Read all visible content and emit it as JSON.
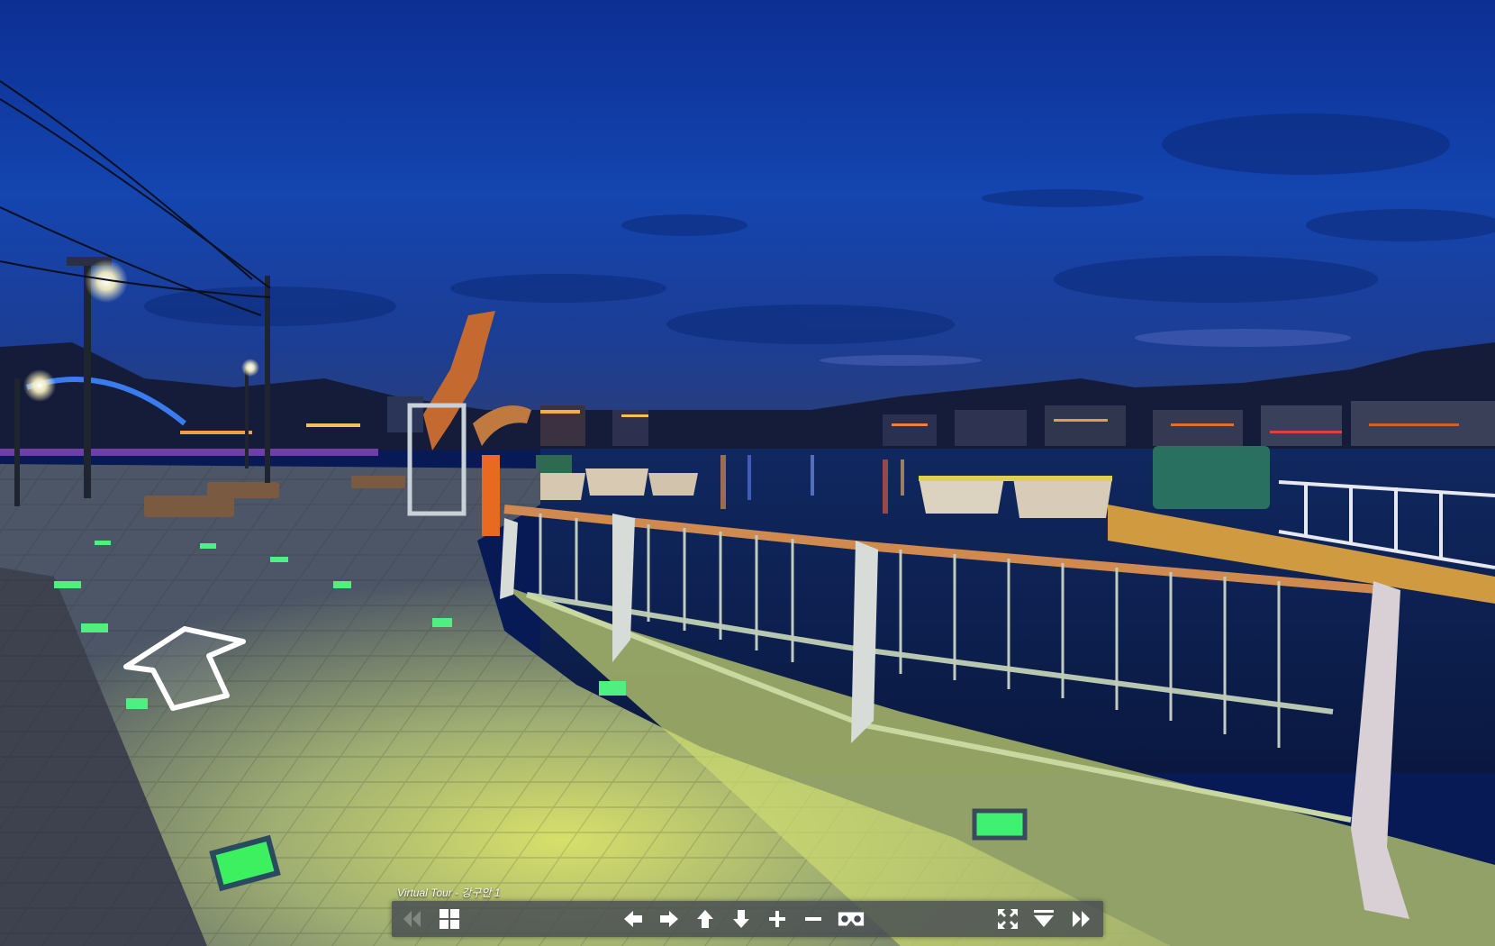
{
  "tour": {
    "title": "Virtual Tour - 강구안 1"
  },
  "toolbar": {
    "buttons": [
      {
        "name": "previous-scene-button",
        "icon": "double-chevron-left-icon",
        "disabled": true
      },
      {
        "name": "thumbnails-button",
        "icon": "grid-icon"
      },
      {
        "name": "pan-left-button",
        "icon": "arrow-left-icon"
      },
      {
        "name": "pan-right-button",
        "icon": "arrow-right-icon"
      },
      {
        "name": "pan-up-button",
        "icon": "arrow-up-icon"
      },
      {
        "name": "pan-down-button",
        "icon": "arrow-down-icon"
      },
      {
        "name": "zoom-in-button",
        "icon": "plus-icon"
      },
      {
        "name": "zoom-out-button",
        "icon": "minus-icon"
      },
      {
        "name": "vr-mode-button",
        "icon": "vr-goggles-icon"
      },
      {
        "name": "fullscreen-button",
        "icon": "fullscreen-icon"
      },
      {
        "name": "hide-controls-button",
        "icon": "collapse-down-icon"
      },
      {
        "name": "next-scene-button",
        "icon": "double-chevron-right-icon"
      }
    ]
  },
  "hotspot": {
    "icon": "navigation-arrow-icon"
  },
  "colors": {
    "sky_top": "#0a2a8c",
    "sky_mid": "#103fa8",
    "horizon": "#1a3a80",
    "railing": "#c0c8c8",
    "ground_light": "#c7d86a",
    "ground_dark": "#5a6470",
    "toolbar": "#464a52"
  }
}
